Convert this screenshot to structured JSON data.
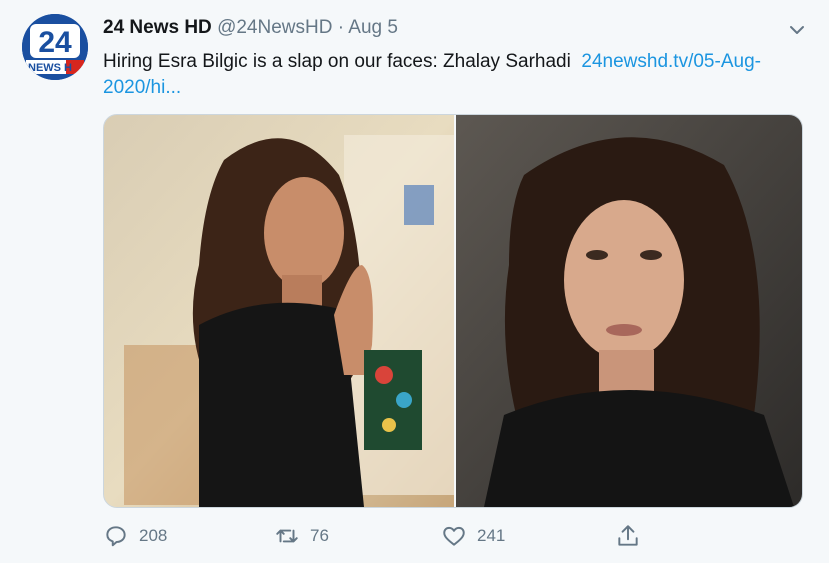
{
  "tweet": {
    "author_name": "24 News HD",
    "handle": "@24NewsHD",
    "separator": "·",
    "date": "Aug 5",
    "text": "Hiring Esra Bilgic is a slap on our faces: Zhalay Sarhadi",
    "link": "24newshd.tv/05-Aug-2020/hi...",
    "avatar_text": "NEWS H",
    "avatar_number": "24"
  },
  "actions": {
    "reply_count": "208",
    "retweet_count": "76",
    "like_count": "241"
  },
  "icons": {
    "caret": "chevron-down-icon",
    "reply": "reply-icon",
    "retweet": "retweet-icon",
    "like": "heart-icon",
    "share": "share-icon"
  },
  "colors": {
    "background": "#f5f8fa",
    "link": "#1b95e0",
    "muted": "#657786",
    "avatar_blue": "#1a4fa0",
    "avatar_red": "#d7261e"
  }
}
